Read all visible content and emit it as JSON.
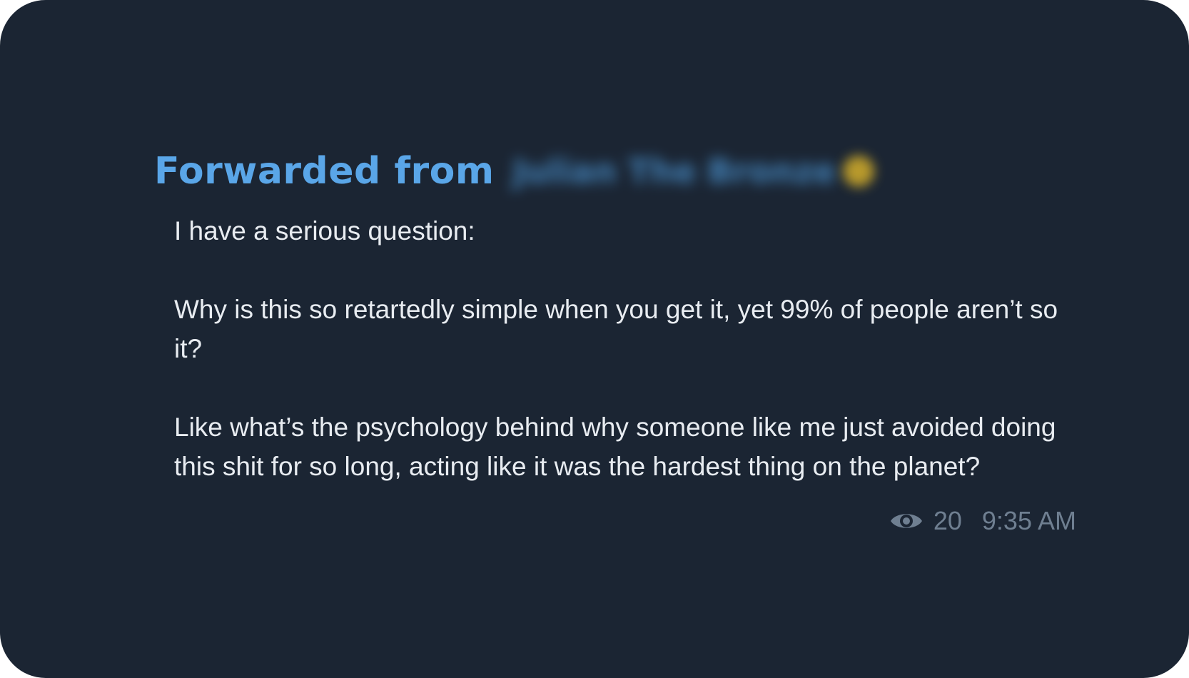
{
  "message": {
    "forward_label": "Forwarded from",
    "source_name": "Julian The Bronze",
    "paragraphs": [
      "I have a serious question:",
      "Why is this so retartedly simple when you get it, yet 99% of people aren’t so it?",
      "Like what’s the psychology behind why someone like me just avoided doing this shit for so long, acting like it was the hardest thing on the planet?"
    ],
    "views": "20",
    "time": "9:35 AM"
  },
  "colors": {
    "background": "#1b2533",
    "forward_accent": "#5aa6e8",
    "text": "#e8ecf1",
    "meta": "#6f7f91",
    "source_dot": "#c9a62b"
  },
  "icons": {
    "views": "eye-icon"
  }
}
